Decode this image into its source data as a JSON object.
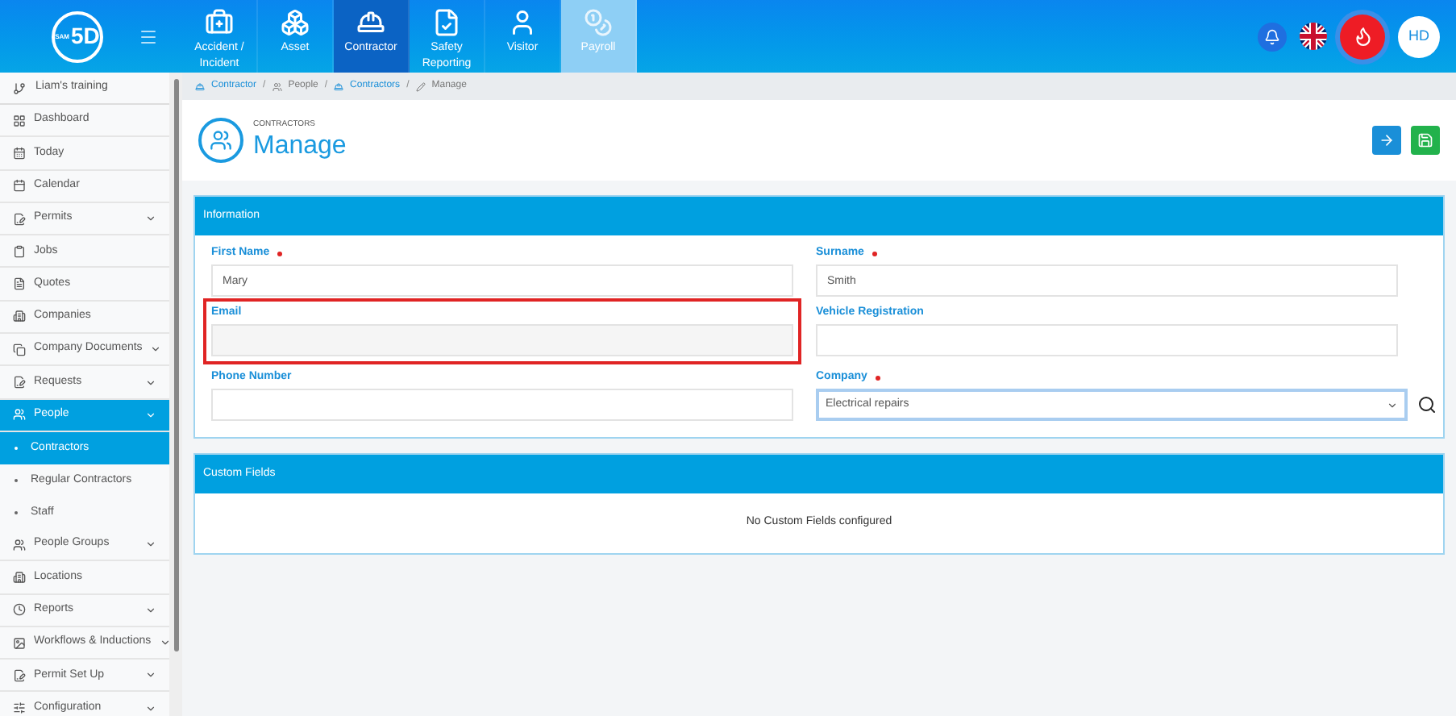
{
  "logo": {
    "text": "5D",
    "small": "SAM"
  },
  "nav_tabs": [
    {
      "label": "Accident / Incident",
      "selected": false,
      "faded": false
    },
    {
      "label": "Asset",
      "selected": false,
      "faded": false
    },
    {
      "label": "Contractor",
      "selected": true,
      "faded": false
    },
    {
      "label": "Safety Reporting",
      "selected": false,
      "faded": false
    },
    {
      "label": "Visitor",
      "selected": false,
      "faded": false
    },
    {
      "label": "Payroll",
      "selected": false,
      "faded": true
    }
  ],
  "user": {
    "initials": "HD"
  },
  "sidebar": {
    "header": "Liam's training",
    "items": [
      {
        "label": "Dashboard",
        "expandable": false,
        "selected": false
      },
      {
        "label": "Today",
        "expandable": false,
        "selected": false
      },
      {
        "label": "Calendar",
        "expandable": false,
        "selected": false
      },
      {
        "label": "Permits",
        "expandable": true,
        "selected": false
      },
      {
        "label": "Jobs",
        "expandable": false,
        "selected": false
      },
      {
        "label": "Quotes",
        "expandable": false,
        "selected": false
      },
      {
        "label": "Companies",
        "expandable": false,
        "selected": false
      },
      {
        "label": "Company Documents",
        "expandable": true,
        "selected": false
      },
      {
        "label": "Requests",
        "expandable": true,
        "selected": false
      },
      {
        "label": "People",
        "expandable": true,
        "selected": true,
        "children": [
          {
            "label": "Contractors",
            "selected": true
          },
          {
            "label": "Regular Contractors",
            "selected": false
          },
          {
            "label": "Staff",
            "selected": false
          }
        ]
      },
      {
        "label": "People Groups",
        "expandable": true,
        "selected": false
      },
      {
        "label": "Locations",
        "expandable": false,
        "selected": false
      },
      {
        "label": "Reports",
        "expandable": true,
        "selected": false
      },
      {
        "label": "Workflows & Inductions",
        "expandable": true,
        "selected": false
      },
      {
        "label": "Permit Set Up",
        "expandable": true,
        "selected": false
      },
      {
        "label": "Configuration",
        "expandable": true,
        "selected": false
      }
    ]
  },
  "breadcrumb": {
    "separator": "/",
    "items": [
      {
        "label": "Contractor",
        "link": true
      },
      {
        "label": "People",
        "link": false
      },
      {
        "label": "Contractors",
        "link": true
      },
      {
        "label": "Manage",
        "link": false
      }
    ]
  },
  "page": {
    "subtitle": "CONTRACTORS",
    "title": "Manage"
  },
  "information": {
    "title": "Information",
    "fields": [
      {
        "label": "First Name",
        "required": true,
        "value": "Mary",
        "kind": "text",
        "highlighted": false
      },
      {
        "label": "Surname",
        "required": true,
        "value": "Smith",
        "kind": "text",
        "highlighted": false
      },
      {
        "label": "Email",
        "required": false,
        "kind": "text",
        "highlighted": true
      },
      {
        "label": "Vehicle Registration",
        "required": false,
        "kind": "text",
        "highlighted": false
      },
      {
        "label": "Phone Number",
        "required": false,
        "kind": "text",
        "highlighted": false
      },
      {
        "label": "Company",
        "required": true,
        "value": "Electrical repairs",
        "kind": "select",
        "highlighted": false
      }
    ]
  },
  "custom_fields": {
    "title": "Custom Fields",
    "message": "No Custom Fields configured"
  }
}
